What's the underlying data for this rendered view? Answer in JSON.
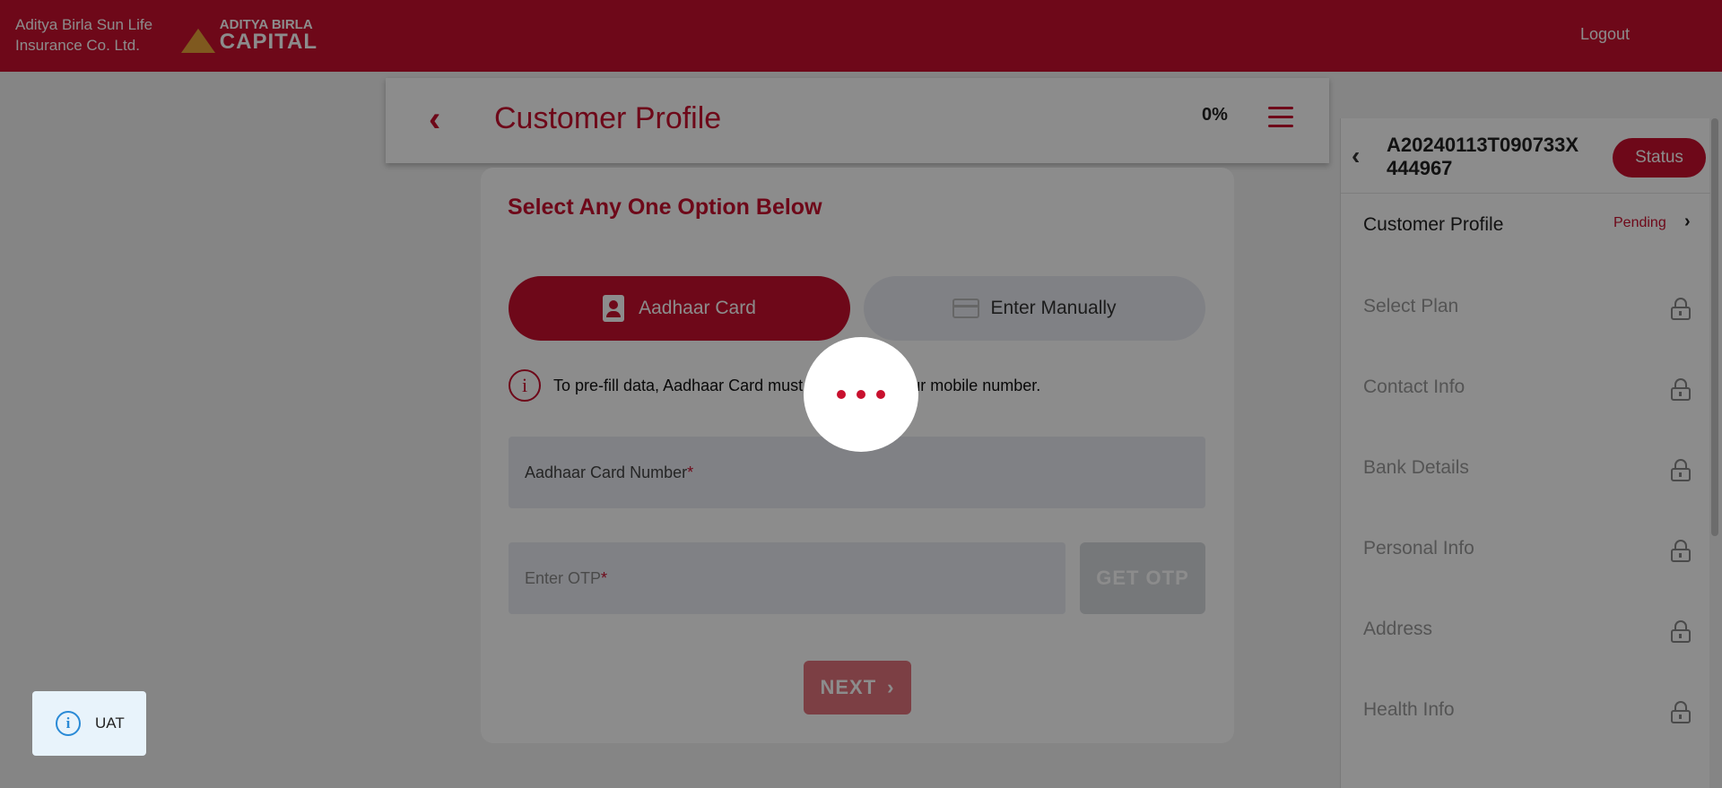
{
  "header": {
    "company_line1": "Aditya Birla Sun Life",
    "company_line2": "Insurance Co. Ltd.",
    "logo_line1": "ADITYA BIRLA",
    "logo_line2": "CAPITAL",
    "logout_label": "Logout",
    "bg_color": "#c8102e"
  },
  "profile_header": {
    "title": "Customer Profile",
    "progress": "0%"
  },
  "main": {
    "title": "Select Any One Option Below",
    "options": [
      {
        "label": "Aadhaar Card",
        "selected": true
      },
      {
        "label": "Enter Manually",
        "selected": false
      }
    ],
    "info_text": "To pre-fill data, Aadhaar Card must be linked to your mobile number.",
    "aadhaar_field": {
      "label": "Aadhaar Card Number",
      "required": "*"
    },
    "otp_field": {
      "label": "Enter OTP",
      "required": "*"
    },
    "get_otp_label": "GET OTP",
    "next_label": "NEXT"
  },
  "side_panel": {
    "application_id_line1": "A20240113T090733X",
    "application_id_line2": "444967",
    "status_label": "Status",
    "items": [
      {
        "label": "Customer Profile",
        "status": "Pending"
      },
      {
        "label": "Select Plan"
      },
      {
        "label": "Contact Info"
      },
      {
        "label": "Bank Details"
      },
      {
        "label": "Personal Info"
      },
      {
        "label": "Address"
      },
      {
        "label": "Health Info"
      }
    ]
  },
  "uat_badge": {
    "label": "UAT"
  },
  "icons": [
    "back-chevron-icon",
    "hamburger-icon",
    "id-card-icon",
    "card-icon",
    "info-icon",
    "lock-icon",
    "chevron-right-icon",
    "loader-dots-icon"
  ]
}
